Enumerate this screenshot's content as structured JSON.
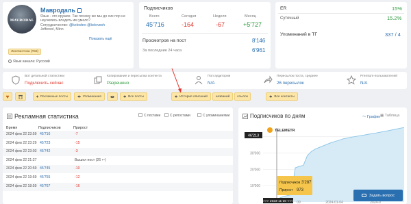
{
  "profile": {
    "avatar_text": "MAVRODAL",
    "name": "Мавродаль",
    "description": "Язык - это оружие. Так почему же мы до сих пор не научились владеть им умело?",
    "contacts_label": "Сотрудничество:",
    "contacts_handle": "@kelovbro @kelovesh",
    "location_city": "Jeffersol, Minn",
    "more_link": "Показать ещё",
    "theme_tag": "Лингвистика (#58)",
    "language": "Язык канала: Русский"
  },
  "subscribers": {
    "title": "Подписчиков",
    "cols": [
      {
        "label": "Всего",
        "value": "45'716",
        "tone": "blue"
      },
      {
        "label": "Сегодня",
        "value": "-164",
        "tone": "red"
      },
      {
        "label": "Неделя",
        "value": "-67",
        "tone": "red"
      },
      {
        "label": "Месяц",
        "value": "+5'727",
        "tone": "green"
      }
    ],
    "views_label": "Просмотров на пост",
    "views_value": "8'146",
    "views_24_label": "За последние 24 часа",
    "views_24_value": "6'961"
  },
  "er": {
    "er_label": "ER",
    "er_value": "15%",
    "daily_label": "Суточный",
    "daily_value": "15.2%",
    "mentions_label": "Упоминаний в ТГ",
    "mentions_value": "337",
    "mentions_total": "/ 4"
  },
  "statbar": [
    {
      "title": "Вот детальной статистики",
      "value": "Подключить сейчас",
      "tone": "red",
      "icon": "shield-icon"
    },
    {
      "title": "Копирование и пересылка контента",
      "value": "Разрешено",
      "tone": "green",
      "icon": "copy-icon"
    },
    {
      "title": "Пол аудитории",
      "value": "N/A",
      "tone": "blue",
      "icon": "people-icon"
    },
    {
      "title": "Пересылок поста, среднее",
      "value": "26 пересылок",
      "tone": "blue",
      "icon": "share-icon"
    },
    {
      "title": "Premium-пользователей",
      "value": "N/A",
      "tone": "blue",
      "icon": "star-icon"
    }
  ],
  "toolbar": {
    "ad_posts": "Рекламные посты",
    "mentions": "Упоминания",
    "all_posts": "Все посты",
    "history": "История описаний",
    "titles": "названий",
    "links": "ссылок",
    "contacts": "Все контакты"
  },
  "ads": {
    "title": "Рекламная статистика",
    "filters": [
      "С постами",
      "С репостами",
      "С упоминаниями"
    ],
    "headers": [
      "Время",
      "Подписчиков",
      "Прирост"
    ],
    "rows": [
      {
        "time": "2024 фев 22 23:59",
        "subs": "45'716",
        "growth": "-7",
        "tone": "red"
      },
      {
        "time": "2024 фев 22 23:29",
        "subs": "45'723",
        "growth": "-15",
        "tone": "red"
      },
      {
        "time": "2024 фев 22 23:03",
        "subs": "45'742",
        "growth": "-3",
        "tone": "red"
      },
      {
        "time": "2024 фев 22 21:27",
        "subs": "",
        "growth": "Вышел пост (26 ↩)",
        "tone": "note"
      },
      {
        "time": "2024 фев 22 20:59",
        "subs": "45'745",
        "growth": "-10",
        "tone": "red"
      },
      {
        "time": "2024 фев 22 19:59",
        "subs": "45'755",
        "growth": "-12",
        "tone": "red"
      },
      {
        "time": "2024 фев 22 18:59",
        "subs": "45'767",
        "growth": "-16",
        "tone": "red"
      }
    ]
  },
  "growth": {
    "title": "Подписчиков по дням",
    "tab_chart": "График",
    "tab_table": "Таблица",
    "watermark": "TELEMETR",
    "tooltip_value": "46'213",
    "tip_subs_label": "Подписчиков",
    "tip_subs_value": "3'287",
    "tip_growth_label": "Прирост",
    "tip_growth_value": "973",
    "tip_date": ">>> 2023-11-20 <<<",
    "ask_button": "Задать вопрос"
  },
  "chart_data": {
    "type": "area",
    "y_ticks": [
      "40'000",
      "30'000",
      "20'000",
      "10'000"
    ],
    "x_ticks": [
      "09",
      "2024-01-04",
      "2024-0"
    ],
    "ylim": [
      0,
      46213
    ],
    "values": [
      1200,
      1500,
      1700,
      2000,
      2314,
      3287,
      3900,
      4500,
      21000,
      21800,
      22500,
      28500,
      31000,
      32500,
      33500,
      34500,
      35500,
      36500,
      37200,
      38000,
      38800,
      39300,
      39800,
      40200,
      40600,
      41000,
      41500,
      41900,
      42300,
      42800,
      43200,
      43700,
      44200,
      44700,
      45200,
      45716
    ],
    "colors": {
      "line": "#8fc7e8",
      "fill": "#d7ebf7"
    }
  }
}
